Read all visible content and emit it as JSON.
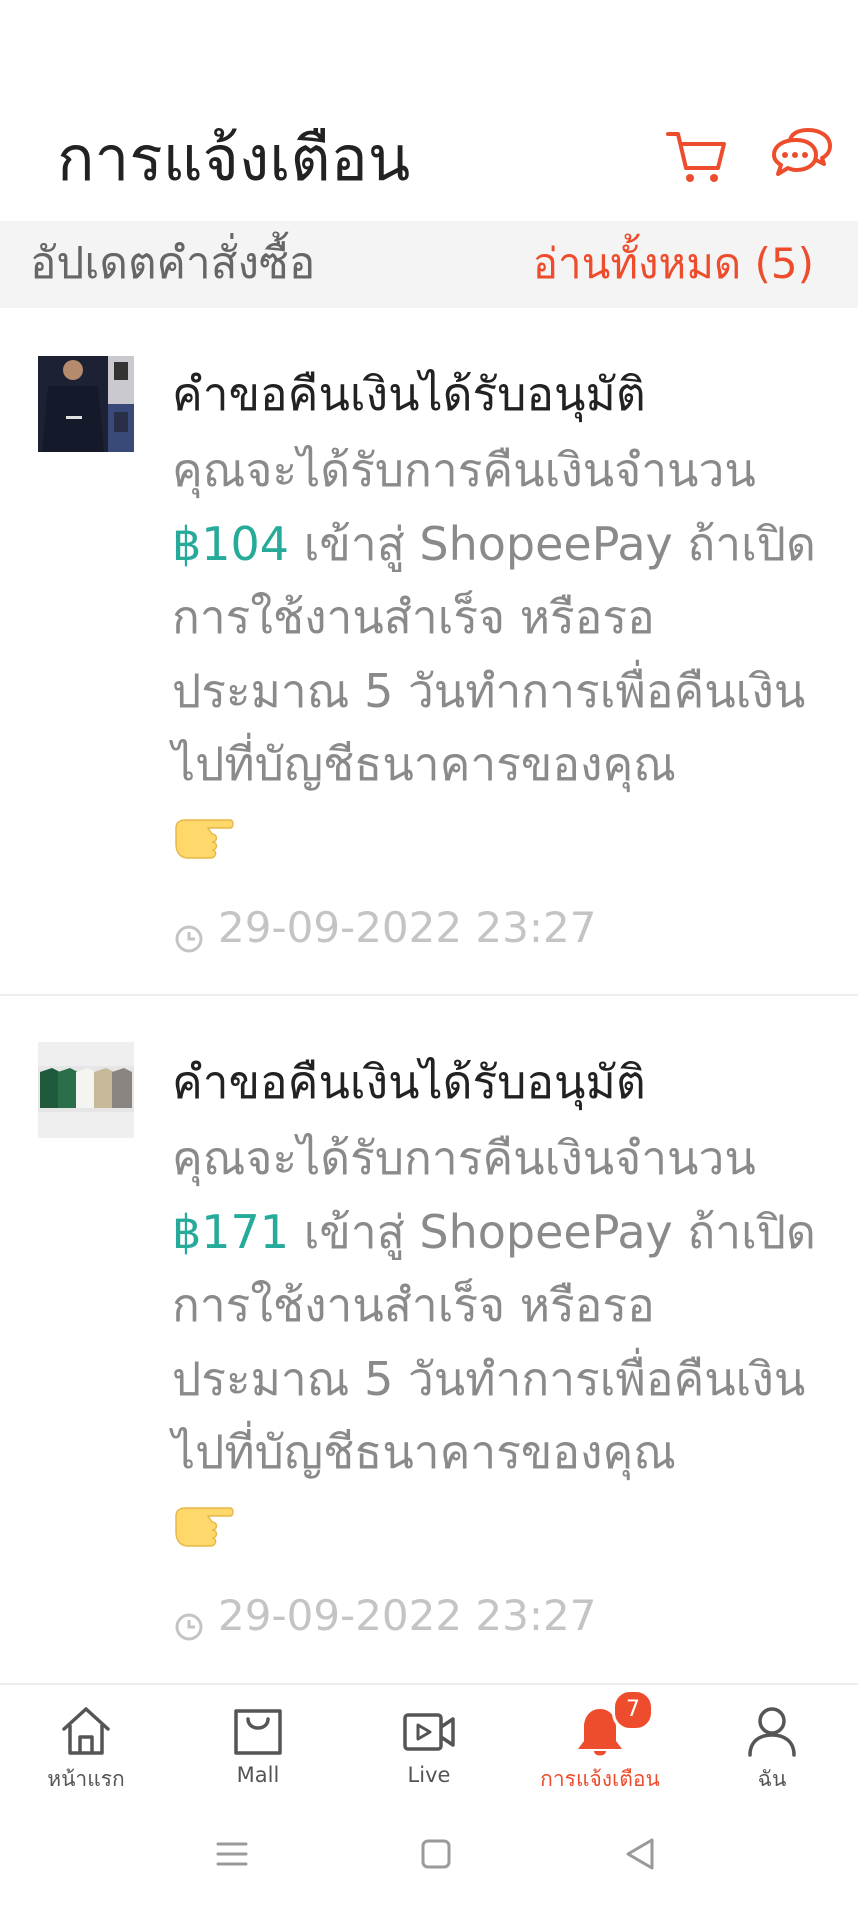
{
  "header": {
    "title": "การแจ้งเตือน",
    "cart_icon": "cart-icon",
    "chat_icon": "chat-icon"
  },
  "section": {
    "title": "อัปเดตคำสั่งซื้อ",
    "action": "อ่านทั้งหมด (5)"
  },
  "notifications": [
    {
      "title": "คำขอคืนเงินได้รับอนุมัติ",
      "body_prefix": "คุณจะได้รับการคืนเงินจำนวน",
      "amount": "฿104",
      "body_suffix": " เข้าสู่ ShopeePay ถ้าเปิดการใช้งานสำเร็จ หรือรอประมาณ 5 วันทำการเพื่อคืนเงินไปที่บัญชีธนาคารของคุณ",
      "emoji": "👉",
      "time": "29-09-2022 23:27"
    },
    {
      "title": "คำขอคืนเงินได้รับอนุมัติ",
      "body_prefix": "คุณจะได้รับการคืนเงินจำนวน",
      "amount": "฿171",
      "body_suffix": " เข้าสู่ ShopeePay ถ้าเปิดการใช้งานสำเร็จ หรือรอประมาณ 5 วันทำการเพื่อคืนเงินไปที่บัญชีธนาคารของคุณ",
      "emoji": "👉",
      "time": "29-09-2022 23:27"
    }
  ],
  "bottom_nav": {
    "items": [
      {
        "label": "หน้าแรก",
        "icon": "home-icon"
      },
      {
        "label": "Mall",
        "icon": "mall-bag-icon"
      },
      {
        "label": "Live",
        "icon": "live-video-icon"
      },
      {
        "label": "การแจ้งเตือน",
        "icon": "bell-icon",
        "badge": "7",
        "active": true
      },
      {
        "label": "ฉัน",
        "icon": "profile-icon"
      }
    ]
  },
  "colors": {
    "accent": "#ee4d2d",
    "amount": "#26aa99",
    "muted_text": "#8a8a8a",
    "time_text": "#c4c4c4"
  }
}
